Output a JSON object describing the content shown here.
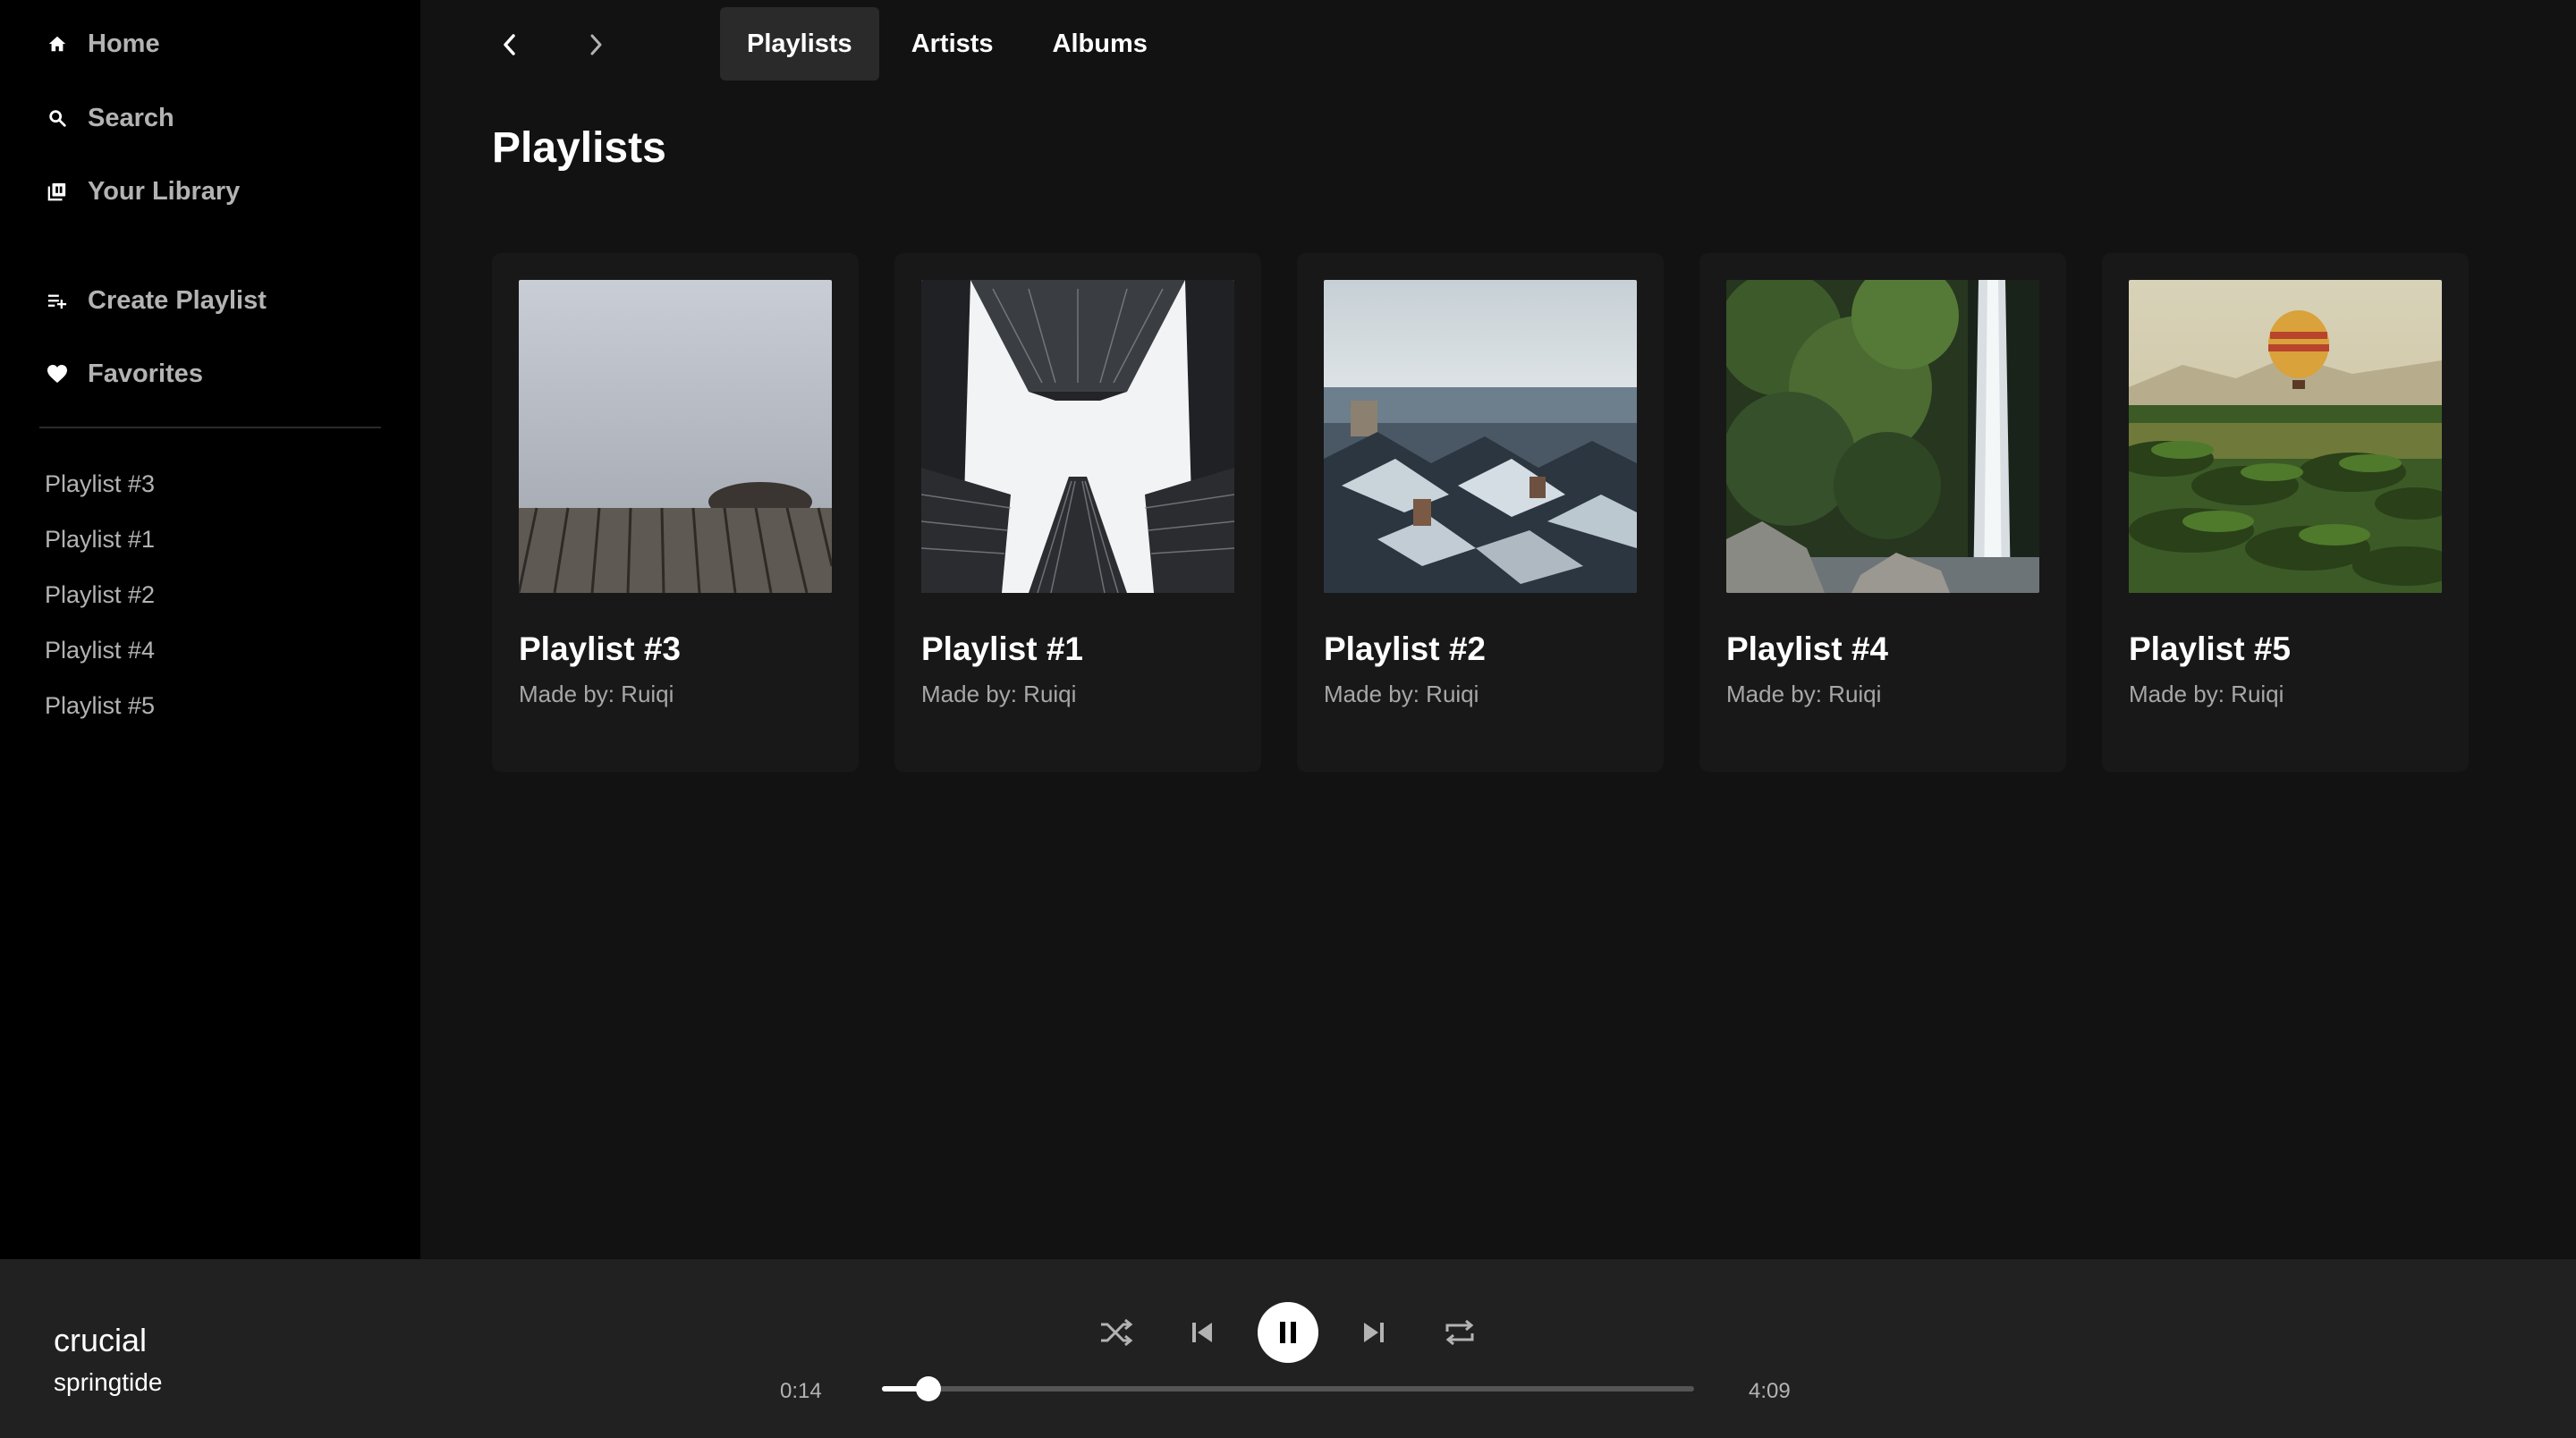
{
  "sidebar": {
    "nav": [
      {
        "label": "Home",
        "icon": "home-icon"
      },
      {
        "label": "Search",
        "icon": "search-icon"
      },
      {
        "label": "Your Library",
        "icon": "library-icon"
      },
      {
        "label": "Create Playlist",
        "icon": "add-playlist-icon"
      },
      {
        "label": "Favorites",
        "icon": "heart-icon"
      }
    ],
    "playlists": [
      "Playlist #3",
      "Playlist #1",
      "Playlist #2",
      "Playlist #4",
      "Playlist #5"
    ]
  },
  "header": {
    "tabs": [
      {
        "label": "Playlists",
        "active": true
      },
      {
        "label": "Artists",
        "active": false
      },
      {
        "label": "Albums",
        "active": false
      }
    ]
  },
  "main": {
    "title": "Playlists",
    "cards": [
      {
        "name": "Playlist #3",
        "made_by": "Made by: Ruiqi"
      },
      {
        "name": "Playlist #1",
        "made_by": "Made by: Ruiqi"
      },
      {
        "name": "Playlist #2",
        "made_by": "Made by: Ruiqi"
      },
      {
        "name": "Playlist #4",
        "made_by": "Made by: Ruiqi"
      },
      {
        "name": "Playlist #5",
        "made_by": "Made by: Ruiqi"
      }
    ]
  },
  "player": {
    "track": "crucial",
    "artist": "springtide",
    "current_time": "0:14",
    "total_time": "4:09",
    "progress_fraction": 0.057
  },
  "colors": {
    "sidebar_bg": "#000000",
    "main_bg": "#121212",
    "card_bg": "#181818",
    "player_bg": "#212121",
    "muted_text": "#b3b3b3"
  }
}
